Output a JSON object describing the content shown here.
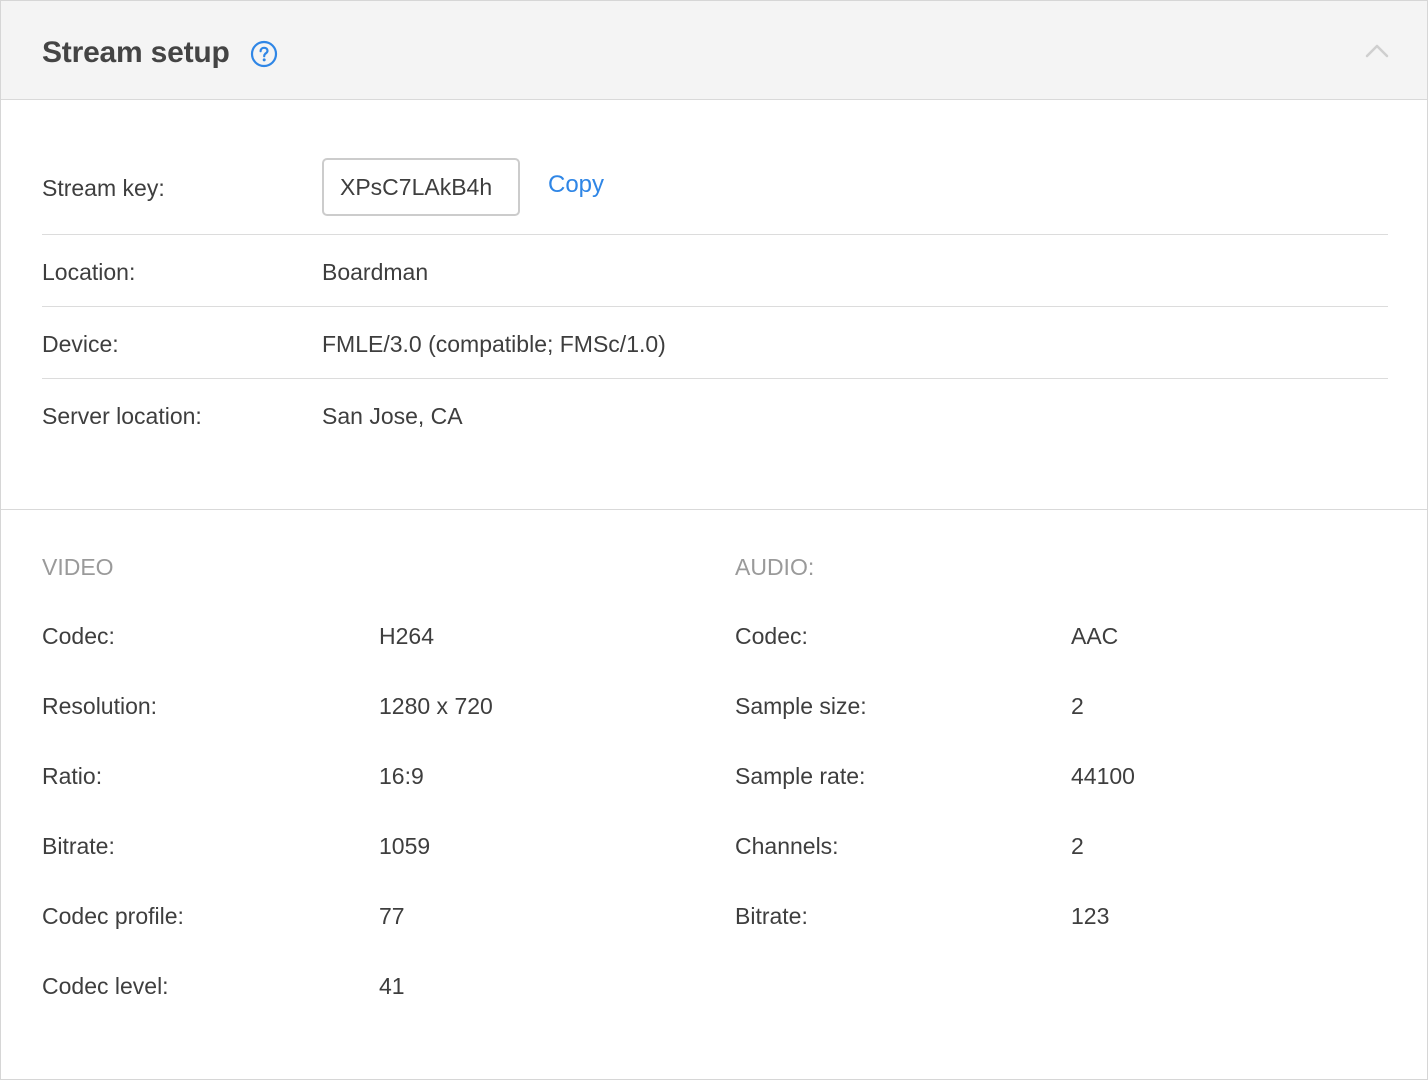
{
  "header": {
    "title": "Stream setup",
    "help_icon": "question-circle-icon",
    "collapse_icon": "chevron-up-icon"
  },
  "stream_info": {
    "stream_key_label": "Stream key:",
    "stream_key_value": "XPsC7LAkB4h",
    "copy_label": "Copy",
    "location_label": "Location:",
    "location_value": "Boardman",
    "device_label": "Device:",
    "device_value": "FMLE/3.0 (compatible; FMSc/1.0)",
    "server_location_label": "Server location:",
    "server_location_value": "San Jose, CA"
  },
  "video": {
    "heading": "VIDEO",
    "rows": [
      {
        "label": "Codec:",
        "value": "H264"
      },
      {
        "label": "Resolution:",
        "value": "1280 x 720"
      },
      {
        "label": "Ratio:",
        "value": "16:9"
      },
      {
        "label": "Bitrate:",
        "value": "1059"
      },
      {
        "label": "Codec profile:",
        "value": "77"
      },
      {
        "label": "Codec level:",
        "value": "41"
      }
    ]
  },
  "audio": {
    "heading": "AUDIO:",
    "rows": [
      {
        "label": "Codec:",
        "value": "AAC"
      },
      {
        "label": "Sample size:",
        "value": "2"
      },
      {
        "label": "Sample rate:",
        "value": "44100"
      },
      {
        "label": "Channels:",
        "value": "2"
      },
      {
        "label": "Bitrate:",
        "value": "123"
      }
    ]
  },
  "colors": {
    "accent": "#2f86e6",
    "header_bg": "#f4f4f4",
    "muted_text": "#9a9a9a"
  }
}
